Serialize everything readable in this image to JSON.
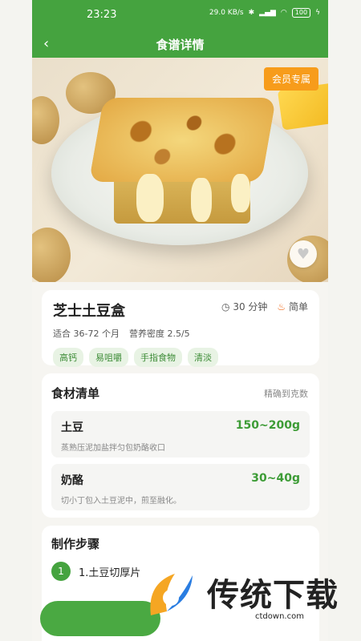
{
  "status": {
    "time": "23:23",
    "net_speed": "29.0 KB/s",
    "battery": "100"
  },
  "nav": {
    "title": "食谱详情"
  },
  "hero": {
    "badge": "会员专属"
  },
  "recipe": {
    "name": "芝士土豆盒",
    "time": "30 分钟",
    "difficulty": "简单",
    "age": "适合 36-72 个月",
    "density": "营养密度 2.5/5",
    "tags": [
      "高钙",
      "易咀嚼",
      "手指食物",
      "清淡"
    ]
  },
  "ingredients": {
    "title": "食材清单",
    "note": "精确到克数",
    "items": [
      {
        "name": "土豆",
        "amount": "150~200g",
        "desc": "蒸熟压泥加盐拌匀包奶酪收口"
      },
      {
        "name": "奶酪",
        "amount": "30~40g",
        "desc": "切小丁包入土豆泥中，煎至融化。"
      }
    ]
  },
  "steps": {
    "title": "制作步骤",
    "items": [
      {
        "num": "1",
        "text": "1.土豆切厚片"
      }
    ]
  },
  "watermark": {
    "brand": "传统下载",
    "url": "ctdown.com"
  },
  "colors": {
    "primary": "#45a33f",
    "badge": "#f79c1b",
    "tag_bg": "#e8f3e4"
  }
}
